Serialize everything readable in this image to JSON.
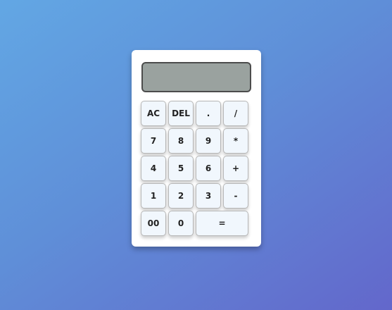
{
  "display": {
    "value": ""
  },
  "keys": [
    {
      "label": "AC"
    },
    {
      "label": "DEL"
    },
    {
      "label": "."
    },
    {
      "label": "/"
    },
    {
      "label": "7"
    },
    {
      "label": "8"
    },
    {
      "label": "9"
    },
    {
      "label": "*"
    },
    {
      "label": "4"
    },
    {
      "label": "5"
    },
    {
      "label": "6"
    },
    {
      "label": "+"
    },
    {
      "label": "1"
    },
    {
      "label": "2"
    },
    {
      "label": "3"
    },
    {
      "label": "-"
    },
    {
      "label": "00"
    },
    {
      "label": "0"
    },
    {
      "label": "="
    }
  ],
  "colors": {
    "background_start": "#62a7e4",
    "background_end": "#6367cb",
    "display_bg": "#9aa29f",
    "key_bg": "#f1f7fd"
  }
}
